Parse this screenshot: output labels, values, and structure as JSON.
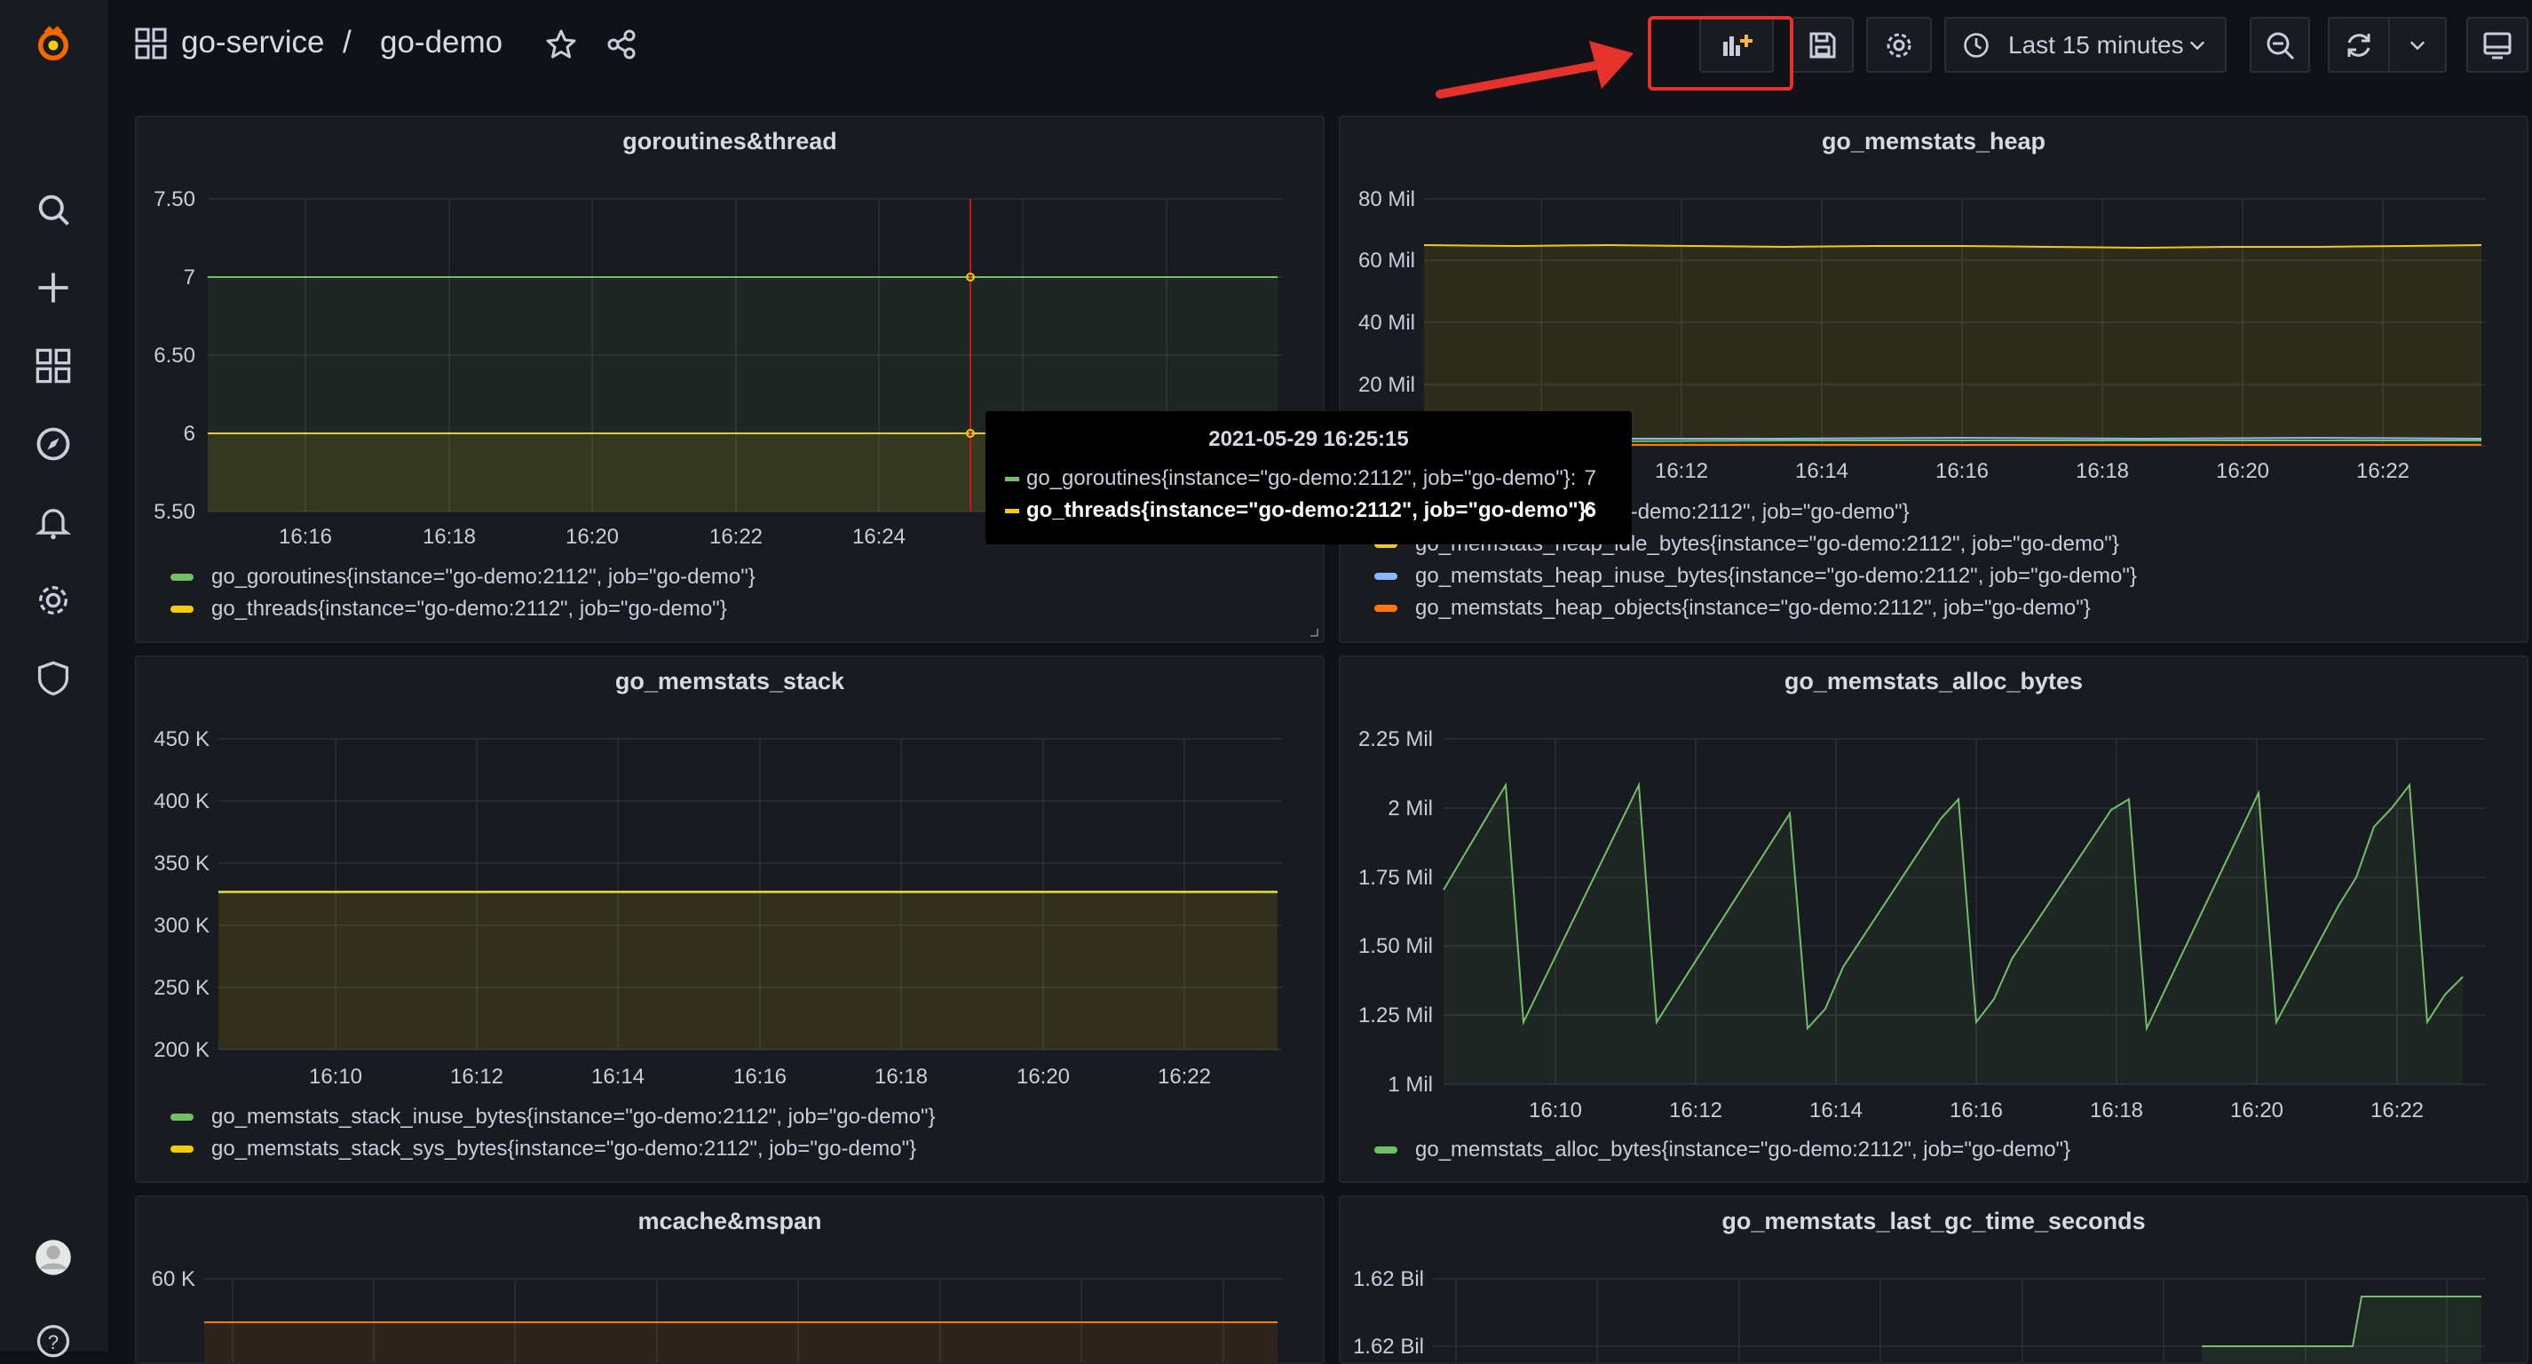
{
  "nav": {
    "icons": [
      "grafana-logo-icon",
      "search-icon",
      "plus-icon",
      "dashboards-icon",
      "explore-icon",
      "alerting-icon",
      "gear-icon",
      "shield-icon",
      "user-avatar-icon",
      "help-icon"
    ]
  },
  "header": {
    "folder": "go-service",
    "separator": "/",
    "dashboard": "go-demo",
    "time_range": "Last 15 minutes"
  },
  "tooltip": {
    "time": "2021-05-29 16:25:15",
    "rows": [
      {
        "label": "go_goroutines{instance=\"go-demo:2112\", job=\"go-demo\"}:",
        "value": "7",
        "color": "#73bf69"
      },
      {
        "label": "go_threads{instance=\"go-demo:2112\", job=\"go-demo\"}:",
        "value": "6",
        "color": "#f2cc0c"
      }
    ]
  },
  "colors": {
    "green": "#73bf69",
    "yellow": "#f2cc0c",
    "blue": "#8ab8ff",
    "orange": "#ff780a",
    "annotation": "#e5322d"
  },
  "panels": [
    {
      "title": "goroutines&thread",
      "chart_data": {
        "type": "line",
        "y_ticks": [
          "7.50",
          "7",
          "6.50",
          "6",
          "5.50"
        ],
        "x_ticks": [
          "16:16",
          "16:18",
          "16:20",
          "16:22",
          "16:24"
        ],
        "ylim": [
          5.5,
          7.5
        ],
        "series": [
          {
            "name": "go_goroutines{instance=\"go-demo:2112\", job=\"go-demo\"}",
            "color": "#73bf69",
            "values": [
              7,
              7
            ]
          },
          {
            "name": "go_threads{instance=\"go-demo:2112\", job=\"go-demo\"}",
            "color": "#f2cc0c",
            "values": [
              6,
              6
            ]
          }
        ]
      }
    },
    {
      "title": "go_memstats_heap",
      "chart_data": {
        "type": "line",
        "y_ticks": [
          "80 Mil",
          "60 Mil",
          "40 Mil",
          "20 Mil"
        ],
        "x_ticks": [
          "16:12",
          "16:14",
          "16:16",
          "16:18",
          "16:20",
          "16:22"
        ],
        "ylim": [
          0,
          80000000
        ],
        "series": [
          {
            "name": "go_memstats_heap_alloc_bytes{instance=\"go-demo:2112\", job=\"go-demo\"}",
            "legend_visible": "oc_bytes{instance=\"go-demo:2112\", job=\"go-demo\"}",
            "color": "#73bf69",
            "values": [
              1500000,
              1500000,
              1600000,
              1500000
            ]
          },
          {
            "name": "go_memstats_heap_idle_bytes{instance=\"go-demo:2112\", job=\"go-demo\"}",
            "color": "#f2cc0c",
            "values": [
              65000000,
              65000000,
              65000000,
              65000000
            ]
          },
          {
            "name": "go_memstats_heap_inuse_bytes{instance=\"go-demo:2112\", job=\"go-demo\"}",
            "color": "#8ab8ff",
            "values": [
              2000000,
              2000000,
              2000000,
              2000000
            ]
          },
          {
            "name": "go_memstats_heap_objects{instance=\"go-demo:2112\", job=\"go-demo\"}",
            "color": "#ff780a",
            "values": [
              10000,
              10000,
              10000,
              10000
            ]
          }
        ]
      }
    },
    {
      "title": "go_memstats_stack",
      "chart_data": {
        "type": "line",
        "y_ticks": [
          "450 K",
          "400 K",
          "350 K",
          "300 K",
          "250 K",
          "200 K"
        ],
        "x_ticks": [
          "16:10",
          "16:12",
          "16:14",
          "16:16",
          "16:18",
          "16:20",
          "16:22"
        ],
        "ylim": [
          200000,
          450000
        ],
        "series": [
          {
            "name": "go_memstats_stack_inuse_bytes{instance=\"go-demo:2112\", job=\"go-demo\"}",
            "color": "#73bf69",
            "values": [
              327680,
              327680
            ]
          },
          {
            "name": "go_memstats_stack_sys_bytes{instance=\"go-demo:2112\", job=\"go-demo\"}",
            "color": "#f2cc0c",
            "values": [
              327680,
              327680
            ]
          }
        ]
      }
    },
    {
      "title": "go_memstats_alloc_bytes",
      "chart_data": {
        "type": "line",
        "y_ticks": [
          "2.25 Mil",
          "2 Mil",
          "1.75 Mil",
          "1.50 Mil",
          "1.25 Mil",
          "1 Mil"
        ],
        "x_ticks": [
          "16:10",
          "16:12",
          "16:14",
          "16:16",
          "16:18",
          "16:20",
          "16:22"
        ],
        "ylim": [
          1000000,
          2250000
        ],
        "series": [
          {
            "name": "go_memstats_alloc_bytes{instance=\"go-demo:2112\", job=\"go-demo\"}",
            "color": "#73bf69",
            "values": [
              1700000,
              2080000,
              1220000,
              1550000,
              2080000,
              1220000,
              1980000,
              1200000,
              1420000,
              1950000,
              2030000,
              1220000,
              1450000,
              1980000,
              2050000,
              1200000,
              2060000,
              1220000,
              1650000,
              1800000,
              2080000,
              1220000,
              1400000
            ]
          }
        ]
      }
    },
    {
      "title": "mcache&mspan",
      "chart_data": {
        "type": "line",
        "y_ticks": [
          "60 K"
        ],
        "x_ticks": [],
        "series": [
          {
            "color": "#ff780a",
            "values": [
              55000,
              55000
            ]
          }
        ]
      }
    },
    {
      "title": "go_memstats_last_gc_time_seconds",
      "chart_data": {
        "type": "line",
        "y_ticks": [
          "1.62 Bil",
          "1.62 Bil"
        ],
        "x_ticks": [],
        "series": [
          {
            "color": "#73bf69",
            "values": [
              1622270000,
              1622270000,
              1622270200,
              1622270200
            ]
          }
        ]
      }
    }
  ]
}
